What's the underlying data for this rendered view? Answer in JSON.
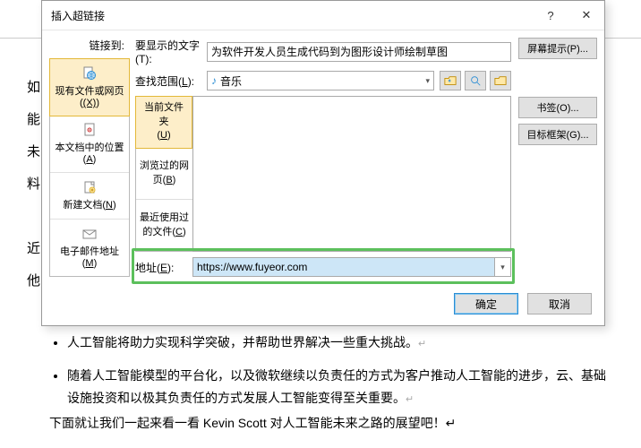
{
  "bg": {
    "chars": "如能未料近他",
    "bullets": [
      "人工智能将助力实现科学突破，并帮助世界解决一些重大挑战。",
      "随着人工智能模型的平台化，以及微软继续以负责任的方式为客户推动人工智能的进步，云、基础设施投资和以极其负责任的方式发展人工智能变得至关重要。"
    ],
    "line": "下面就让我们一起来看一看  Kevin Scott  对人工智能未来之路的展望吧！"
  },
  "dialog": {
    "title": "插入超链接",
    "link_to": "链接到:",
    "display_text_label": "要显示的文字(T):",
    "display_text_value": "为软件开发人员生成代码到为图形设计师绘制草图",
    "screentip": "屏幕提示(P)...",
    "lookin_label": "查找范围(L):",
    "lookin_value": "音乐",
    "sidebar": [
      {
        "label": "现有文件或网页",
        "key": "(X)"
      },
      {
        "label": "本文档中的位置",
        "key": "(A)"
      },
      {
        "label": "新建文档",
        "key": "(N)"
      },
      {
        "label": "电子邮件地址",
        "key": "(M)"
      }
    ],
    "tabs": [
      {
        "label": "当前文件夹",
        "key": "(U)"
      },
      {
        "label": "浏览过的网页",
        "key": "(B)"
      },
      {
        "label": "最近使用过的文件",
        "key": "(C)"
      }
    ],
    "addr_label": "地址(E):",
    "addr_value": "https://www.fuyeor.com",
    "bookmark": "书签(O)...",
    "target_frame": "目标框架(G)...",
    "ok": "确定",
    "cancel": "取消"
  }
}
